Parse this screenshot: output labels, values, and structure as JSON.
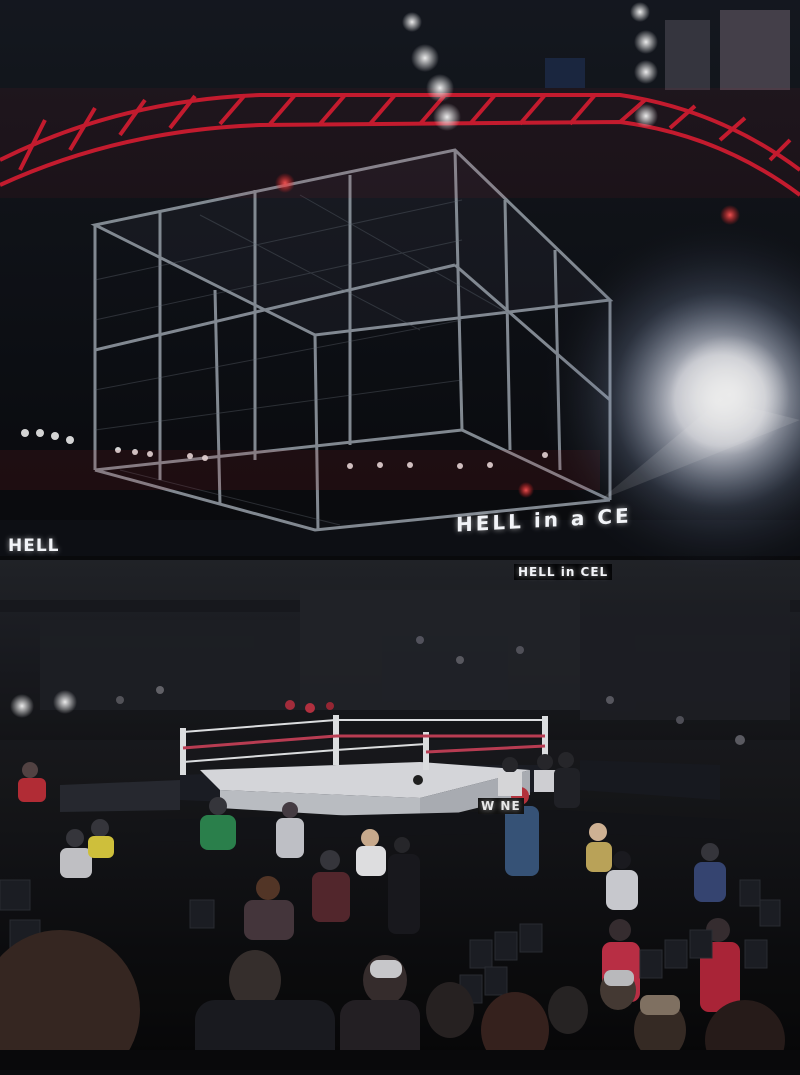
{
  "photo": {
    "subject": "",
    "signs": {
      "left": "HELL",
      "right": "HELL in a CE",
      "board": "HELL in CEL",
      "apron": "W NE"
    },
    "colors": {
      "truss": "#d21e32",
      "cage": "#9aa3ad",
      "ropes_red": "#c8425a",
      "ropes_white": "#eef0f2",
      "canvas": "#e6e8ec",
      "background": "#0b0c0f",
      "glare": "#ffffff"
    }
  }
}
